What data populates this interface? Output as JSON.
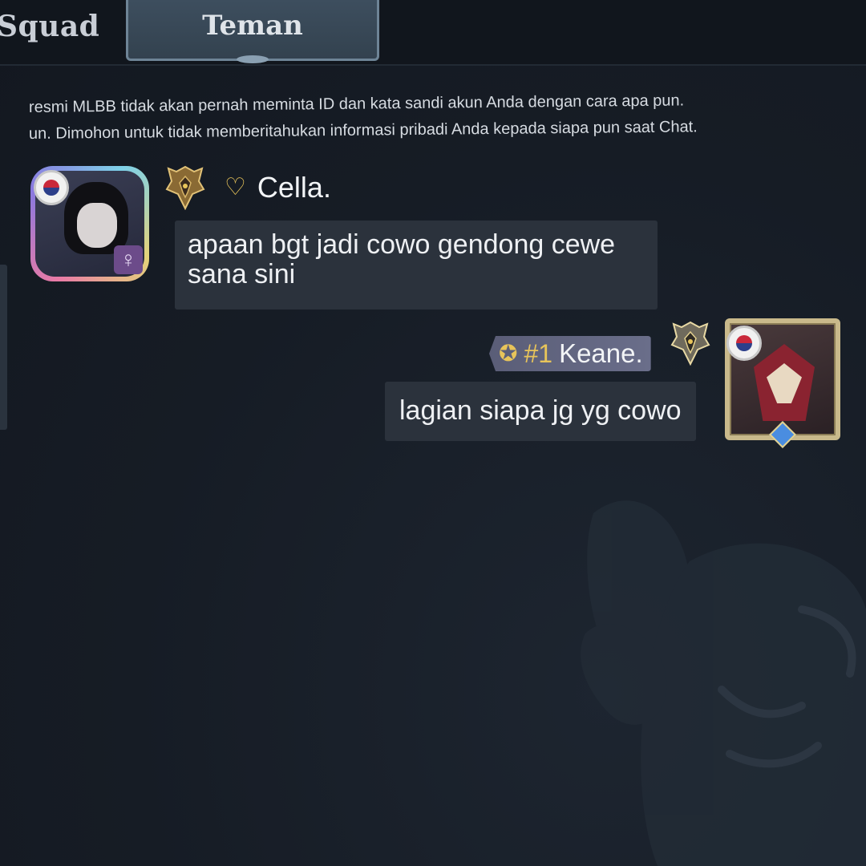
{
  "tabs": {
    "squad_label": "Squad",
    "teman_label": "Teman"
  },
  "notice": {
    "line1": "resmi MLBB tidak akan pernah meminta ID dan kata sandi akun Anda dengan cara apa pun.",
    "line2": "un. Dimohon untuk tidak memberitahukan informasi pribadi Anda kepada siapa pun saat Chat."
  },
  "messages": [
    {
      "sender": "Cella.",
      "side": "left",
      "icons": [
        "korea-flag-icon",
        "rank-emblem-icon",
        "heart-icon",
        "female-icon"
      ],
      "gender_symbol": "♀",
      "heart_symbol": "♡",
      "text_line1": "apaan bgt jadi cowo gendong cewe",
      "text_line2": "sana sini"
    },
    {
      "sender": "Keane.",
      "side": "right",
      "rank": "#1",
      "star_symbol": "✪",
      "icons": [
        "korea-flag-icon",
        "rank-emblem-icon",
        "star-icon"
      ],
      "text": "lagian siapa jg yg cowo"
    }
  ],
  "colors": {
    "background": "#151b24",
    "bubble": "#2b323c",
    "gold_accent": "#e8c45a",
    "tab_active": "#3d4e5e"
  }
}
